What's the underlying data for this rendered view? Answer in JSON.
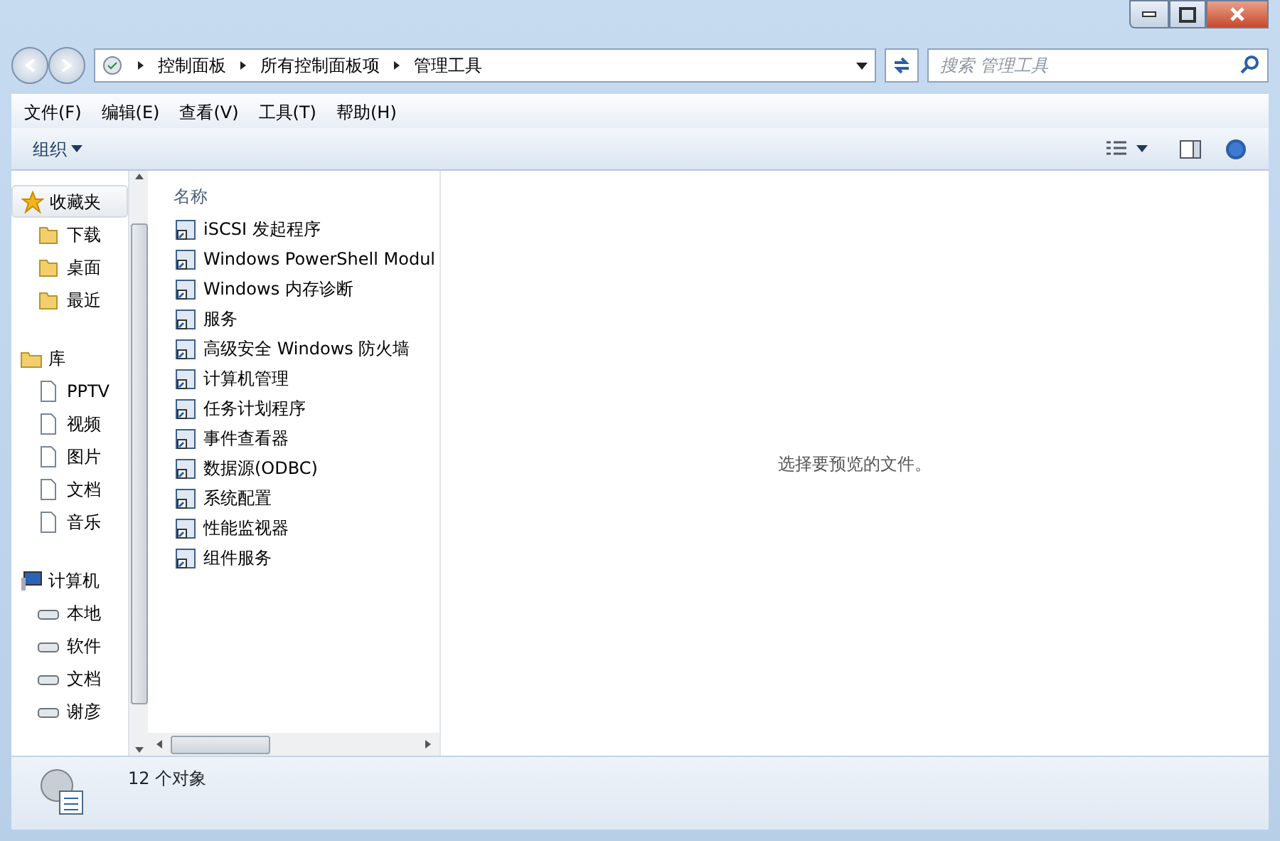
{
  "address_bar": {
    "crumbs": [
      "控制面板",
      "所有控制面板项",
      "管理工具"
    ]
  },
  "search": {
    "placeholder": "搜索 管理工具"
  },
  "menu": [
    "文件(F)",
    "编辑(E)",
    "查看(V)",
    "工具(T)",
    "帮助(H)"
  ],
  "toolbar": {
    "organize": "组织"
  },
  "sidebar": [
    {
      "label": "收藏夹",
      "selected": true,
      "children": [
        {
          "label": "下载"
        },
        {
          "label": "桌面"
        },
        {
          "label": "最近"
        }
      ]
    },
    {
      "label": "库",
      "selected": false,
      "children": [
        {
          "label": "PPTV"
        },
        {
          "label": "视频"
        },
        {
          "label": "图片"
        },
        {
          "label": "文档"
        },
        {
          "label": "音乐"
        }
      ]
    },
    {
      "label": "计算机",
      "selected": false,
      "children": [
        {
          "label": "本地"
        },
        {
          "label": "软件"
        },
        {
          "label": "文档"
        },
        {
          "label": "谢彦"
        }
      ]
    }
  ],
  "file_list": {
    "column": "名称",
    "items": [
      "iSCSI 发起程序",
      "Windows PowerShell Modul",
      "Windows 内存诊断",
      "服务",
      "高级安全 Windows 防火墙",
      "计算机管理",
      "任务计划程序",
      "事件查看器",
      "数据源(ODBC)",
      "系统配置",
      "性能监视器",
      "组件服务"
    ]
  },
  "preview": {
    "message": "选择要预览的文件。"
  },
  "status_bar": {
    "count": "12 个对象"
  }
}
